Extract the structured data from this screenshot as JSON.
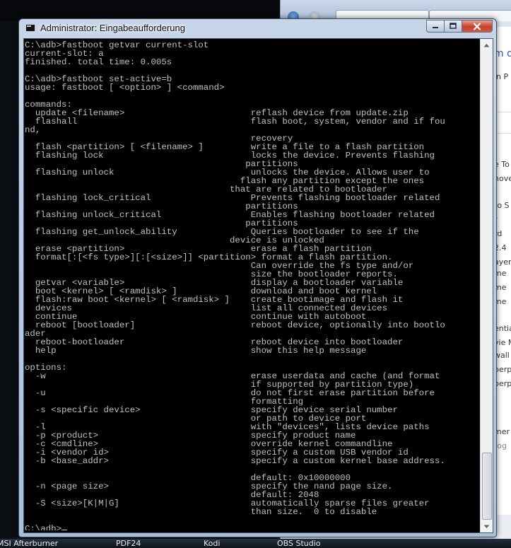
{
  "window": {
    "title": "Administrator: Eingabeaufforderung"
  },
  "console": {
    "lines": [
      "C:\\adb>fastboot getvar current-slot",
      "current-slot: a",
      "finished. total time: 0.005s",
      "",
      "C:\\adb>fastboot set-active=b",
      "usage: fastboot [ <option> ] <command>",
      "",
      "commands:",
      "  update <filename>                        reflash device from update.zip",
      "  flashall                                 flash boot, system, vendor and if fou",
      "nd,",
      "                                           recovery",
      "  flash <partition> [ <filename> ]         write a file to a flash partition",
      "  flashing lock                            locks the device. Prevents flashing",
      "                                          partitions",
      "  flashing unlock                          unlocks the device. Allows user to",
      "                                         flash any partition except the ones",
      "                                       that are related to bootloader",
      "  flashing lock_critical                   Prevents flashing bootloader related",
      "                                          partitions",
      "  flashing unlock_critical                 Enables flashing bootloader related",
      "                                          partitions",
      "  flashing get_unlock_ability              Queries bootloader to see if the",
      "                                       device is unlocked",
      "  erase <partition>                        erase a flash partition",
      "  format[:[<fs type>][:[<size>]] <partition> format a flash partition.",
      "                                           Can override the fs type and/or",
      "                                           size the bootloader reports.",
      "  getvar <variable>                        display a bootloader variable",
      "  boot <kernel> [ <ramdisk> ]              download and boot kernel",
      "  flash:raw boot <kernel> [ <ramdisk> ]    create bootimage and flash it",
      "  devices                                  list all connected devices",
      "  continue                                 continue with autoboot",
      "  reboot [bootloader]                      reboot device, optionally into bootlo",
      "ader",
      "  reboot-bootloader                        reboot device into bootloader",
      "  help                                     show this help message",
      "",
      "options:",
      "  -w                                       erase userdata and cache (and format",
      "                                           if supported by partition type)",
      "  -u                                       do not first erase partition before",
      "                                           formatting",
      "  -s <specific device>                     specify device serial number",
      "                                           or path to device port",
      "  -l                                       with \"devices\", lists device paths",
      "  -p <product>                             specify product name",
      "  -c <cmdline>                             override kernel commandline",
      "  -i <vendor id>                           specify a custom USB vendor id",
      "  -b <base_addr>                           specify a custom kernel base address.",
      "",
      "                                           default: 0x10000000",
      "  -n <page size>                           specify the nand page size.",
      "                                           default: 2048",
      "  -S <size>[K|M|G]                         automatically sparse files greater",
      "                                           than size.  0 to disable",
      "",
      "C:\\adb>"
    ]
  },
  "taskbar": {
    "items": [
      "MSI Afterburner",
      "PDF24",
      "Kodi",
      "OBS Studio"
    ]
  },
  "background_window": {
    "fragments": [
      "m d",
      "in P",
      "e To",
      "nove",
      "to S",
      "r",
      "rd",
      "2.4",
      "ayer",
      "me",
      "me",
      "me",
      "entia",
      "vie M",
      "wall",
      "berp",
      "berp",
      "mer",
      "rog"
    ]
  },
  "colors": {
    "console_bg": "#000000",
    "console_text": "#c0c0c0",
    "close_button": "#c4402a"
  }
}
